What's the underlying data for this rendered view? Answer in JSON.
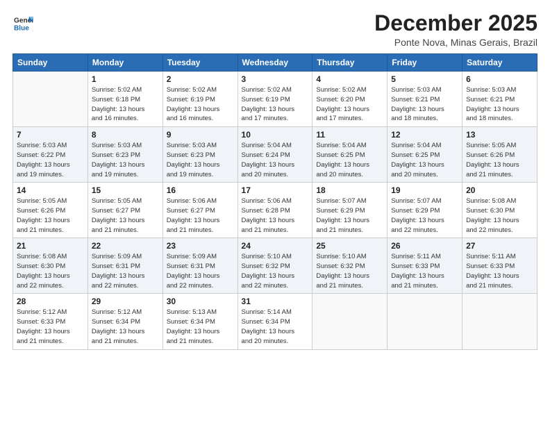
{
  "logo": {
    "line1": "General",
    "line2": "Blue"
  },
  "title": "December 2025",
  "subtitle": "Ponte Nova, Minas Gerais, Brazil",
  "days_of_week": [
    "Sunday",
    "Monday",
    "Tuesday",
    "Wednesday",
    "Thursday",
    "Friday",
    "Saturday"
  ],
  "weeks": [
    [
      {
        "day": "",
        "info": ""
      },
      {
        "day": "1",
        "info": "Sunrise: 5:02 AM\nSunset: 6:18 PM\nDaylight: 13 hours\nand 16 minutes."
      },
      {
        "day": "2",
        "info": "Sunrise: 5:02 AM\nSunset: 6:19 PM\nDaylight: 13 hours\nand 16 minutes."
      },
      {
        "day": "3",
        "info": "Sunrise: 5:02 AM\nSunset: 6:19 PM\nDaylight: 13 hours\nand 17 minutes."
      },
      {
        "day": "4",
        "info": "Sunrise: 5:02 AM\nSunset: 6:20 PM\nDaylight: 13 hours\nand 17 minutes."
      },
      {
        "day": "5",
        "info": "Sunrise: 5:03 AM\nSunset: 6:21 PM\nDaylight: 13 hours\nand 18 minutes."
      },
      {
        "day": "6",
        "info": "Sunrise: 5:03 AM\nSunset: 6:21 PM\nDaylight: 13 hours\nand 18 minutes."
      }
    ],
    [
      {
        "day": "7",
        "info": "Sunrise: 5:03 AM\nSunset: 6:22 PM\nDaylight: 13 hours\nand 19 minutes."
      },
      {
        "day": "8",
        "info": "Sunrise: 5:03 AM\nSunset: 6:23 PM\nDaylight: 13 hours\nand 19 minutes."
      },
      {
        "day": "9",
        "info": "Sunrise: 5:03 AM\nSunset: 6:23 PM\nDaylight: 13 hours\nand 19 minutes."
      },
      {
        "day": "10",
        "info": "Sunrise: 5:04 AM\nSunset: 6:24 PM\nDaylight: 13 hours\nand 20 minutes."
      },
      {
        "day": "11",
        "info": "Sunrise: 5:04 AM\nSunset: 6:25 PM\nDaylight: 13 hours\nand 20 minutes."
      },
      {
        "day": "12",
        "info": "Sunrise: 5:04 AM\nSunset: 6:25 PM\nDaylight: 13 hours\nand 20 minutes."
      },
      {
        "day": "13",
        "info": "Sunrise: 5:05 AM\nSunset: 6:26 PM\nDaylight: 13 hours\nand 21 minutes."
      }
    ],
    [
      {
        "day": "14",
        "info": "Sunrise: 5:05 AM\nSunset: 6:26 PM\nDaylight: 13 hours\nand 21 minutes."
      },
      {
        "day": "15",
        "info": "Sunrise: 5:05 AM\nSunset: 6:27 PM\nDaylight: 13 hours\nand 21 minutes."
      },
      {
        "day": "16",
        "info": "Sunrise: 5:06 AM\nSunset: 6:27 PM\nDaylight: 13 hours\nand 21 minutes."
      },
      {
        "day": "17",
        "info": "Sunrise: 5:06 AM\nSunset: 6:28 PM\nDaylight: 13 hours\nand 21 minutes."
      },
      {
        "day": "18",
        "info": "Sunrise: 5:07 AM\nSunset: 6:29 PM\nDaylight: 13 hours\nand 21 minutes."
      },
      {
        "day": "19",
        "info": "Sunrise: 5:07 AM\nSunset: 6:29 PM\nDaylight: 13 hours\nand 22 minutes."
      },
      {
        "day": "20",
        "info": "Sunrise: 5:08 AM\nSunset: 6:30 PM\nDaylight: 13 hours\nand 22 minutes."
      }
    ],
    [
      {
        "day": "21",
        "info": "Sunrise: 5:08 AM\nSunset: 6:30 PM\nDaylight: 13 hours\nand 22 minutes."
      },
      {
        "day": "22",
        "info": "Sunrise: 5:09 AM\nSunset: 6:31 PM\nDaylight: 13 hours\nand 22 minutes."
      },
      {
        "day": "23",
        "info": "Sunrise: 5:09 AM\nSunset: 6:31 PM\nDaylight: 13 hours\nand 22 minutes."
      },
      {
        "day": "24",
        "info": "Sunrise: 5:10 AM\nSunset: 6:32 PM\nDaylight: 13 hours\nand 22 minutes."
      },
      {
        "day": "25",
        "info": "Sunrise: 5:10 AM\nSunset: 6:32 PM\nDaylight: 13 hours\nand 21 minutes."
      },
      {
        "day": "26",
        "info": "Sunrise: 5:11 AM\nSunset: 6:33 PM\nDaylight: 13 hours\nand 21 minutes."
      },
      {
        "day": "27",
        "info": "Sunrise: 5:11 AM\nSunset: 6:33 PM\nDaylight: 13 hours\nand 21 minutes."
      }
    ],
    [
      {
        "day": "28",
        "info": "Sunrise: 5:12 AM\nSunset: 6:33 PM\nDaylight: 13 hours\nand 21 minutes."
      },
      {
        "day": "29",
        "info": "Sunrise: 5:12 AM\nSunset: 6:34 PM\nDaylight: 13 hours\nand 21 minutes."
      },
      {
        "day": "30",
        "info": "Sunrise: 5:13 AM\nSunset: 6:34 PM\nDaylight: 13 hours\nand 21 minutes."
      },
      {
        "day": "31",
        "info": "Sunrise: 5:14 AM\nSunset: 6:34 PM\nDaylight: 13 hours\nand 20 minutes."
      },
      {
        "day": "",
        "info": ""
      },
      {
        "day": "",
        "info": ""
      },
      {
        "day": "",
        "info": ""
      }
    ]
  ]
}
